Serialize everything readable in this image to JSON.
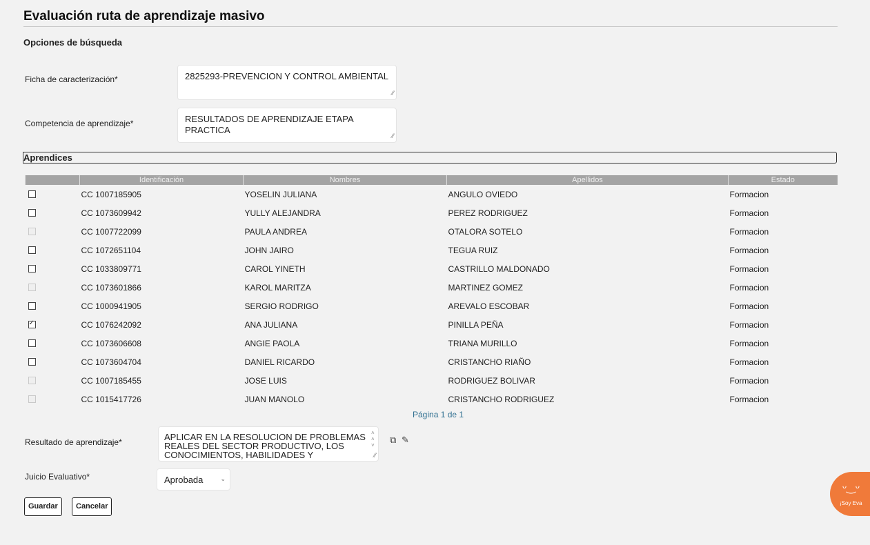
{
  "page": {
    "title": "Evaluación ruta de aprendizaje masivo",
    "subtitle": "Opciones de búsqueda"
  },
  "form": {
    "ficha_label": "Ficha de caracterización*",
    "ficha_value": "2825293-PREVENCION Y CONTROL AMBIENTAL",
    "competencia_label": "Competencia de aprendizaje*",
    "competencia_value": "RESULTADOS DE APRENDIZAJE ETAPA PRACTICA",
    "resultado_label": "Resultado de aprendizaje*",
    "resultado_value": "APLICAR EN LA RESOLUCION DE PROBLEMAS REALES DEL SECTOR PRODUCTIVO, LOS CONOCIMIENTOS, HABILIDADES Y DESTREZAS",
    "juicio_label": "Juicio Evaluativo*",
    "juicio_value": "Aprobada"
  },
  "aprendices": {
    "section_title": "Aprendices",
    "columns": [
      "Identificación",
      "Nombres",
      "Apellidos",
      "Estado"
    ],
    "rows": [
      {
        "id": "CC 1007185905",
        "nombres": "YOSELIN JULIANA",
        "apellidos": "ANGULO OVIEDO",
        "estado": "Formacion",
        "checked": false,
        "disabled": false
      },
      {
        "id": "CC 1073609942",
        "nombres": "YULLY ALEJANDRA",
        "apellidos": "PEREZ RODRIGUEZ",
        "estado": "Formacion",
        "checked": false,
        "disabled": false
      },
      {
        "id": "CC 1007722099",
        "nombres": "PAULA ANDREA",
        "apellidos": "OTALORA SOTELO",
        "estado": "Formacion",
        "checked": false,
        "disabled": true
      },
      {
        "id": "CC 1072651104",
        "nombres": "JOHN JAIRO",
        "apellidos": "TEGUA RUIZ",
        "estado": "Formacion",
        "checked": false,
        "disabled": false
      },
      {
        "id": "CC 1033809771",
        "nombres": "CAROL YINETH",
        "apellidos": "CASTRILLO MALDONADO",
        "estado": "Formacion",
        "checked": false,
        "disabled": false
      },
      {
        "id": "CC 1073601866",
        "nombres": "KAROL MARITZA",
        "apellidos": "MARTINEZ GOMEZ",
        "estado": "Formacion",
        "checked": false,
        "disabled": true
      },
      {
        "id": "CC 1000941905",
        "nombres": "SERGIO RODRIGO",
        "apellidos": "AREVALO ESCOBAR",
        "estado": "Formacion",
        "checked": false,
        "disabled": false
      },
      {
        "id": "CC 1076242092",
        "nombres": "ANA JULIANA",
        "apellidos": "PINILLA PEÑA",
        "estado": "Formacion",
        "checked": true,
        "disabled": false
      },
      {
        "id": "CC 1073606608",
        "nombres": "ANGIE PAOLA",
        "apellidos": "TRIANA MURILLO",
        "estado": "Formacion",
        "checked": false,
        "disabled": false
      },
      {
        "id": "CC 1073604704",
        "nombres": "DANIEL RICARDO",
        "apellidos": "CRISTANCHO RIAÑO",
        "estado": "Formacion",
        "checked": false,
        "disabled": false
      },
      {
        "id": "CC 1007185455",
        "nombres": "JOSE LUIS",
        "apellidos": "RODRIGUEZ BOLIVAR",
        "estado": "Formacion",
        "checked": false,
        "disabled": true
      },
      {
        "id": "CC 1015417726",
        "nombres": "JUAN MANOLO",
        "apellidos": "CRISTANCHO RODRIGUEZ",
        "estado": "Formacion",
        "checked": false,
        "disabled": true
      }
    ],
    "pager": "Página 1 de 1"
  },
  "buttons": {
    "guardar": "Guardar",
    "cancelar": "Cancelar"
  },
  "mascot": {
    "text": "¡Soy Eva"
  }
}
